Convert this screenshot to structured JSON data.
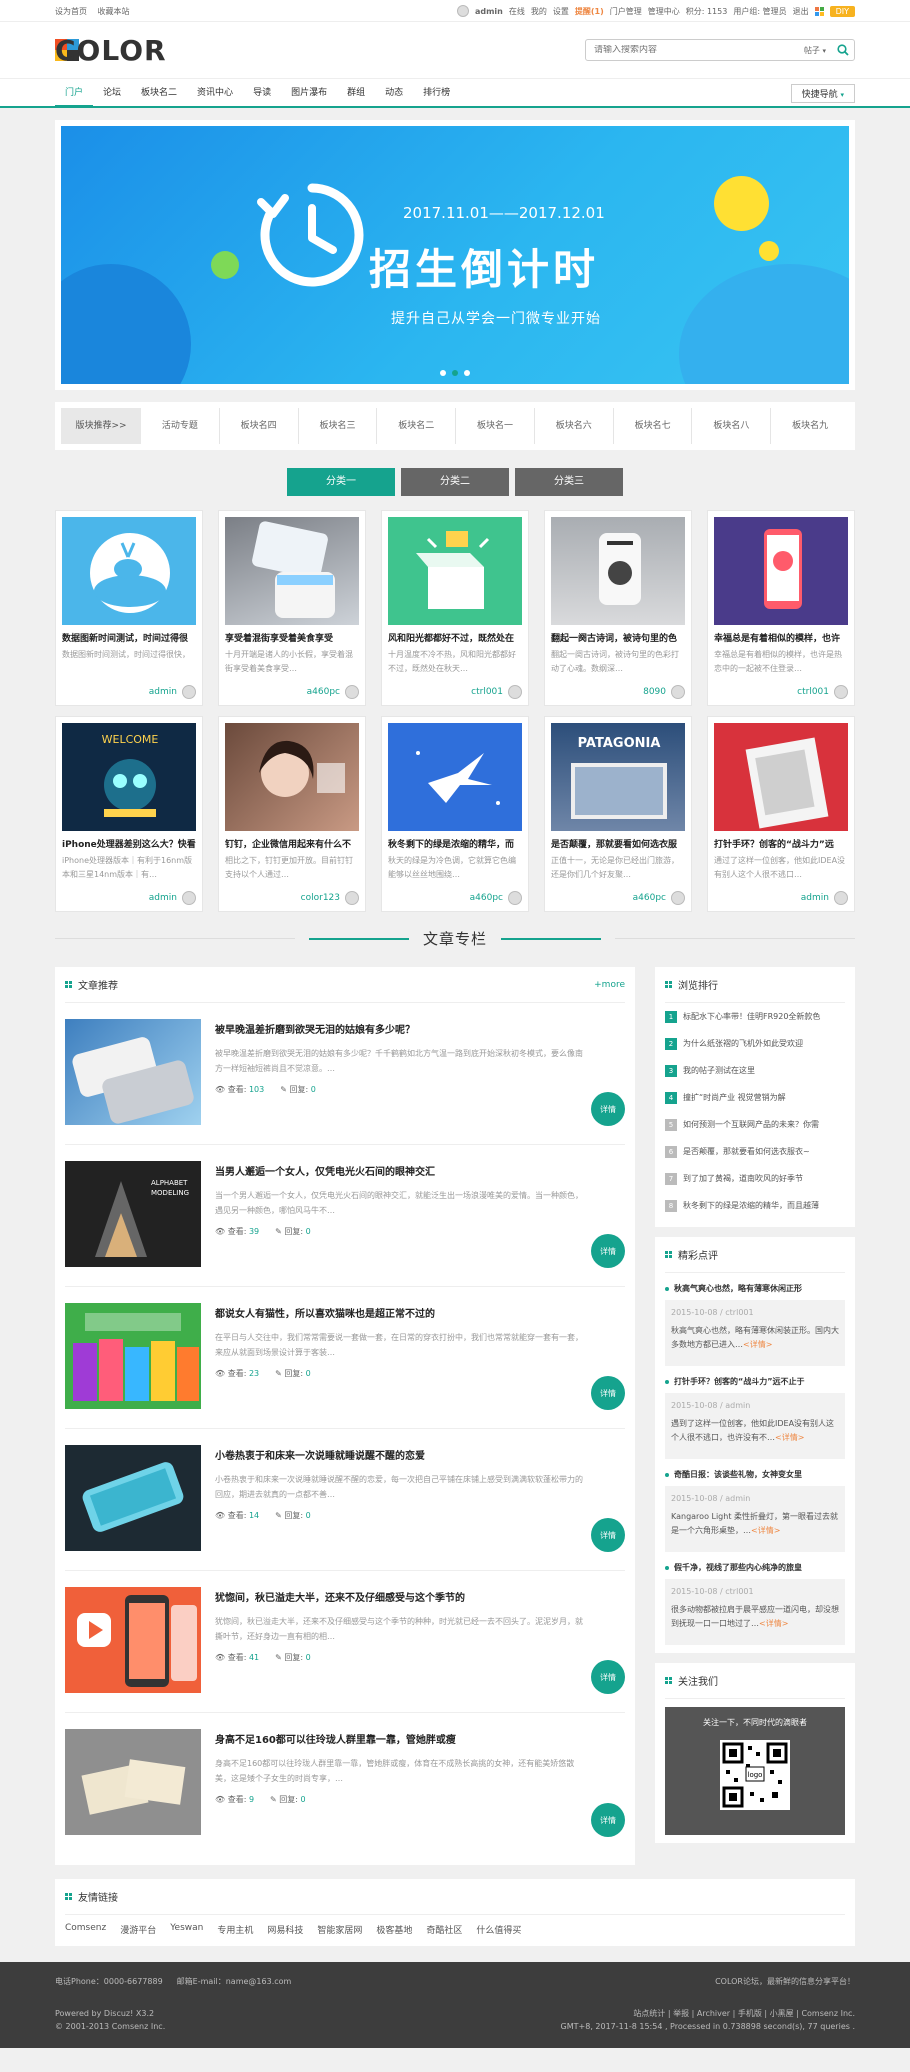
{
  "topbar": {
    "left": [
      "设为首页",
      "收藏本站"
    ],
    "user": "admin",
    "status": "在线",
    "links": [
      "我的",
      "设置"
    ],
    "notice": "提醒(1)",
    "manage": [
      "门户管理",
      "管理中心"
    ],
    "points": "积分: 1153",
    "group": "用户组: 管理员",
    "logout": "退出",
    "diy": "DIY"
  },
  "logo": {
    "text": "COLOR"
  },
  "search": {
    "placeholder": "请输入搜索内容",
    "type": "帖子"
  },
  "nav": {
    "items": [
      "门户",
      "论坛",
      "板块名二",
      "资讯中心",
      "导读",
      "图片瀑布",
      "群组",
      "动态",
      "排行榜"
    ],
    "quick": "快捷导航"
  },
  "banner": {
    "date": "2017.11.01——2017.12.01",
    "title": "招生倒计时",
    "subtitle": "提升自己从学会一门微专业开始"
  },
  "boards": {
    "label": "版块推荐>>",
    "items": [
      "活动专题",
      "板块名四",
      "板块名三",
      "板块名二",
      "板块名一",
      "板块名六",
      "板块名七",
      "板块名八",
      "板块名九"
    ]
  },
  "tabs": [
    "分类一",
    "分类二",
    "分类三"
  ],
  "cards": [
    {
      "title": "数据图新时间测试，时间过得很",
      "desc": "数据图新时间测试，时间过得很快，",
      "user": "admin"
    },
    {
      "title": "享受着混街享受着美食享受",
      "desc": "十月开端是诸人的小长假，享受着混街享受着美食享受…",
      "user": "a460pc"
    },
    {
      "title": "风和阳光都都好不过，既然处在",
      "desc": "十月温度不冷不热，风和阳光都都好不过，既然处在秋天…",
      "user": "ctrl001"
    },
    {
      "title": "翻起一阕古诗词，被诗句里的色",
      "desc": "翻起一阕古诗词，被诗句里的色彩打动了心魂。数纲深…",
      "user": "8090"
    },
    {
      "title": "幸福总是有着相似的模样，也许",
      "desc": "幸福总是有着相似的模样，也许是热恋中的一起被不住登录…",
      "user": "ctrl001"
    },
    {
      "title": "iPhone处理器差别这么大？快看",
      "desc": "iPhone处理器版本｜有利于16nm版本和三星14nm版本｜有…",
      "user": "admin"
    },
    {
      "title": "钉钉，企业微信用起来有什么不",
      "desc": "相比之下，钉钉更加开放。目前钉钉支持以个人通过…",
      "user": "color123"
    },
    {
      "title": "秋冬剩下的绿是浓缩的精华，而",
      "desc": "秋天的绿是为冷色调，它就算它色编能够以丝丝地围绕…",
      "user": "a460pc"
    },
    {
      "title": "是否颠覆，那就要看如何选衣服",
      "desc": "正值十一，无论是你已经出门旅游，还是你们几个好友聚…",
      "user": "a460pc"
    },
    {
      "title": "打针手环？创客的“战斗力”远",
      "desc": "通过了这样一位创客，他如此IDEA没有别人这个人很不逃口…",
      "user": "admin"
    }
  ],
  "section": {
    "title": "文章专栏"
  },
  "articles": {
    "title": "文章推荐",
    "more": "+more",
    "view_label": "查看:",
    "reply_label": "回复:",
    "detail": "详情",
    "items": [
      {
        "title": "被早晚温差折磨到欲哭无泪的姑娘有多少呢？",
        "desc": "被早晚温差折磨到欲哭无泪的姑娘有多少呢？千千鹤鹤如北方气温一路到底开始深秋初冬模式，要么像南方一样短袖短裤尚且不觉凉意。…",
        "views": "103",
        "replies": "0"
      },
      {
        "title": "当男人邂逅一个女人，仅凭电光火石间的眼神交汇",
        "desc": "当一个男人邂逅一个女人，仅凭电光火石间的眼神交汇，就能泛生出一场浪漫唯美的爱情。当一种颜色，遇见另一种颜色，哪怕风马牛不…",
        "views": "39",
        "replies": "0"
      },
      {
        "title": "都说女人有猫性，所以喜欢猫咪也是超正常不过的",
        "desc": "在平日与人交往中，我们常常需要说一套做一套，在日常的穿衣打扮中，我们也常常就能穿一套有一套，来应从就面到场景设计算于客装…",
        "views": "23",
        "replies": "0"
      },
      {
        "title": "小卷热衷于和床来一次说睡就睡说醒不醒的恋爱",
        "desc": "小卷热衷于和床来一次说睡就睡说醒不醒的恋爱，每一次把自己平铺在床铺上感受到满满软软蓬松带力的回应，期进去就真的一点都不善…",
        "views": "14",
        "replies": "0"
      },
      {
        "title": "犹惚间，秋已溢走大半，还来不及仔细感受与这个季节的",
        "desc": "犹惚间，秋已溢走大半，还来不及仔细感受与这个季节的种种，时光就已经一去不回头了。泥泥岁月，就撕叶节，还好身边一直有相的相…",
        "views": "41",
        "replies": "0"
      },
      {
        "title": "身高不足160都可以往玲珑人群里靠一靠，管她胖或瘦",
        "desc": "身高不足160都可以往玲珑人群里靠一靠，管她胖或瘦，体育在不成熟长高挑的女神，还有能美矫悠散美，这是矮个子女生的时尚专享，…",
        "views": "9",
        "replies": "0"
      }
    ]
  },
  "ranking": {
    "title": "浏览排行",
    "items": [
      "标配水下心率带！佳明FR920全新款色",
      "为什么纸张褶的飞机外如此受欢迎",
      "我的帖子测试在这里",
      "撞扩“时尚产业 视觉营销为解",
      "如何预测一个互联网产品的未来？你需",
      "是否颠覆，那就要看如何选衣服衣~",
      "到了加了黄褐，道南吹风的好季节",
      "秋冬剩下的绿是浓缩的精华，而且越薄"
    ]
  },
  "comments": {
    "title": "精彩点评",
    "more": "详情",
    "items": [
      {
        "title": "秋高气爽心也然，略有薄寒休闲正形",
        "meta": "2015-10-08 / ctrl001",
        "text": "秋高气爽心也然，略有薄寒休闲装正形。国内大多数地方都已进入…"
      },
      {
        "title": "打针手环？创客的“战斗力”远不止于",
        "meta": "2015-10-08 / admin",
        "text": "遇到了这样一位创客，他如此IDEA没有别人这个人很不逃口，也许没有不…"
      },
      {
        "title": "奇酷日报：该谈些礼物，女神变女里",
        "meta": "2015-10-08 / admin",
        "text": "Kangaroo Light 柔性折叠灯，第一眼看过去就是一个六角形桌垫，…"
      },
      {
        "title": "假千净，视线了那些内心纯净的旅皇",
        "meta": "2015-10-08 / ctrl001",
        "text": "很多动物都被拉肩于晨平感应一道闪电，却没想到抚现一口一口地过了…"
      }
    ]
  },
  "follow": {
    "title": "关注我们",
    "text": "关注一下，不同时代的滴眼者",
    "qr": "logo"
  },
  "links": {
    "title": "友情链接",
    "items": [
      "Comsenz",
      "漫游平台",
      "Yeswan",
      "专用主机",
      "网易科技",
      "智能家居网",
      "极客基地",
      "奇酷社区",
      "什么值得买"
    ]
  },
  "footer": {
    "phone": "电话Phone：0000-6677889",
    "email": "邮箱E-mail：name@163.com",
    "slogan": "COLOR论坛，最新鲜的信息分享平台！",
    "powered": "Powered by Discuz! X3.2",
    "copyright": "© 2001-2013 Comsenz Inc.",
    "links": "站点统计 | 举报 | Archiver | 手机版 | 小黑屋 | Comsenz Inc.",
    "gmt": "GMT+8, 2017-11-8 15:54 , Processed in 0.738898 second(s), 77 queries ."
  },
  "colors": {
    "accent": "#15a38e",
    "footer": "#3d3d3d",
    "diy": "#f7b21f"
  }
}
